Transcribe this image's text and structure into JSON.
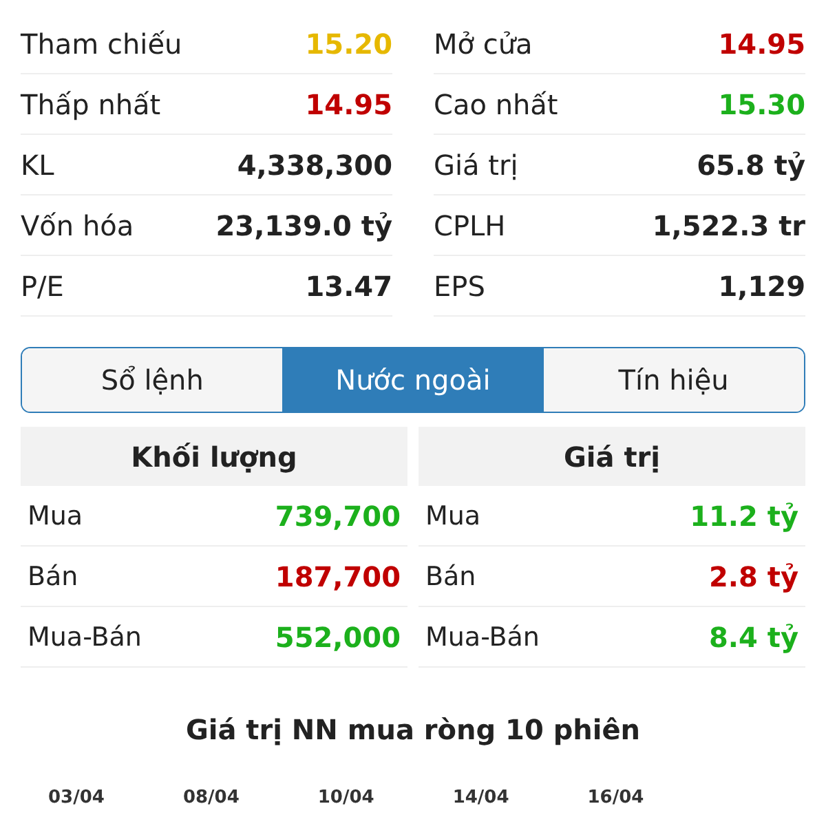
{
  "stats": [
    {
      "label": "Tham chiếu",
      "value": "15.20",
      "color": "#e6b800"
    },
    {
      "label": "Mở cửa",
      "value": "14.95",
      "color": "#c00000"
    },
    {
      "label": "Thấp nhất",
      "value": "14.95",
      "color": "#c00000"
    },
    {
      "label": "Cao nhất",
      "value": "15.30",
      "color": "#1cb01c"
    },
    {
      "label": "KL",
      "value": "4,338,300",
      "color": "#222222"
    },
    {
      "label": "Giá trị",
      "value": "65.8 tỷ",
      "color": "#222222"
    },
    {
      "label": "Vốn hóa",
      "value": "23,139.0 tỷ",
      "color": "#222222"
    },
    {
      "label": "CPLH",
      "value": "1,522.3 tr",
      "color": "#222222"
    },
    {
      "label": "P/E",
      "value": "13.47",
      "color": "#222222"
    },
    {
      "label": "EPS",
      "value": "1,129",
      "color": "#222222"
    }
  ],
  "tabs": [
    {
      "label": "Sổ lệnh",
      "selected": false
    },
    {
      "label": "Nước ngoài",
      "selected": true
    },
    {
      "label": "Tín hiệu",
      "selected": false
    }
  ],
  "foreign_tables": [
    {
      "title": "Khối lượng",
      "rows": [
        {
          "label": "Mua",
          "value": "739,700",
          "color": "#1cb01c"
        },
        {
          "label": "Bán",
          "value": "187,700",
          "color": "#c00000"
        },
        {
          "label": "Mua-Bán",
          "value": "552,000",
          "color": "#1cb01c"
        }
      ]
    },
    {
      "title": "Giá trị",
      "rows": [
        {
          "label": "Mua",
          "value": "11.2 tỷ",
          "color": "#1cb01c"
        },
        {
          "label": "Bán",
          "value": "2.8 tỷ",
          "color": "#c00000"
        },
        {
          "label": "Mua-Bán",
          "value": "8.4 tỷ",
          "color": "#1cb01c"
        }
      ]
    }
  ],
  "chart": {
    "title": "Giá trị NN mua ròng 10 phiên",
    "x_labels": [
      "03/04",
      "08/04",
      "10/04",
      "14/04",
      "16/04"
    ]
  }
}
